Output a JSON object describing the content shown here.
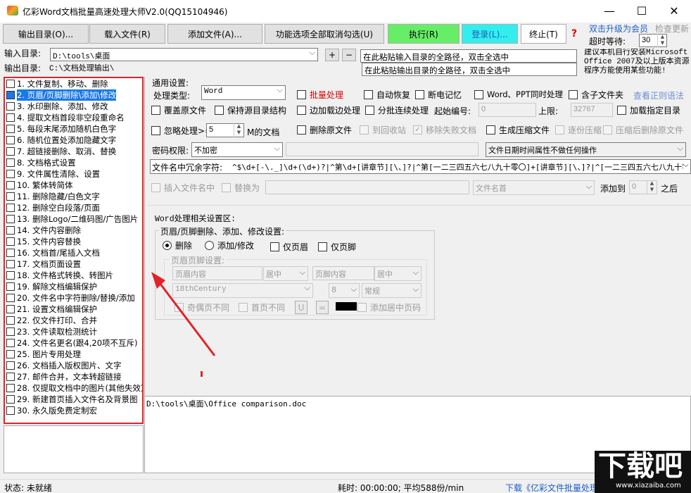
{
  "window": {
    "title": "亿彩Word文档批量高速处理大师V2.0(QQ15104946)",
    "controls": {
      "minimize": "—",
      "maximize": "☐",
      "close": "✕"
    }
  },
  "toolbar": {
    "output_dir": "输出目录(O)...",
    "load_file": "载入文件(R)",
    "add_file": "添加文件(A)...",
    "toggle_all": "功能选项全部取消勾选(U)",
    "execute": "执行(R)",
    "login": "登录(L)...",
    "stop": "终止(T)",
    "help": "?",
    "upgrade": "双击升级为会员",
    "check_update": "检查更新",
    "timeout_label": "超时等待:",
    "timeout_value": "30"
  },
  "paths": {
    "input_label": "输入目录:",
    "input_value": "D:\\tools\\桌面",
    "output_label": "输出目录:",
    "output_value": "C:\\文档处理输出\\",
    "input_hint": "在此粘贴输入目录的全路径，双击全选中",
    "output_hint": "在此粘贴输出目录的全路径，双击全选中",
    "add_btn": "+",
    "remove_btn": "−",
    "notice": "建议本机自行安装Microsoft Office 2007及以上版本资源 程序方能使用某些功能!"
  },
  "function_list": [
    "1. 文件复制、移动、删除",
    "2. 页眉/页脚删除\\添加\\修改",
    "3. 水印删除、添加、修改",
    "4. 提取文档首段非空段重命名",
    "5. 每段末尾添加随机白色字",
    "6. 随机位置处添加隐藏文字",
    "7. 超链接删除、取消、替换",
    "8. 文档格式设置",
    "9. 文件属性清除、设置",
    "10. 繁体转简体",
    "11. 删除隐藏/白色文字",
    "12. 删除空白段落/页面",
    "13. 删除Logo/二维码图/广告图片",
    "14. 文件内容删除",
    "15. 文件内容替换",
    "16. 文档首/尾插入文档",
    "17. 文档页面设置",
    "18. 文件格式转换、转图片",
    "19. 解除文档编辑保护",
    "20. 文件名中字符删除/替换/添加",
    "21. 设置文档编辑保护",
    "22. 仅文件打印、合并",
    "23. 文件读取检测统计",
    "24. 文件名更名(跟4,20项不互斥)",
    "25. 图片专用处理",
    "26. 文档插入版权图片、文字",
    "27. 邮件合并，文本转超链接",
    "28. 仅提取文档中的图片(其他失效)",
    "29. 新建首页插入文件名及背景图",
    "30. 永久版免费定制宏"
  ],
  "general": {
    "section": "通用设置:",
    "type_label": "处理类型:",
    "type_value": "Word",
    "batch": "批量处理",
    "auto_restore": "自动恢复",
    "power_memory": "断电记忆",
    "word_ppt": "Word、PPT同时处理",
    "subfolder": "含子文件夹",
    "regex_link": "查看正则语法",
    "overwrite": "覆盖原文件",
    "keep_structure": "保持源目录结构",
    "side_process": "边加载边处理",
    "batch_continuous": "分批连续处理",
    "start_no_label": "起始编号:",
    "start_no_value": "0",
    "upper_label": "上限:",
    "upper_value": "32767",
    "load_dir": "加载指定目录",
    "ignore_label": "忽略处理>=",
    "ignore_value": "5",
    "ignore_unit": "M的文档",
    "delete_source": "删除原文件",
    "to_recycle": "到回收站",
    "remove_failed": "移除失败文档",
    "gen_zip": "生成压缩文件",
    "one_by_one": "逐份压缩",
    "delete_after_zip": "压缩后删除原文件",
    "password_label": "密码权限:",
    "password_value": "不加密",
    "date_option": "文件日期时间属性不做任何操作",
    "redundant_label": "文件名中冗余字符:",
    "redundant_value": "^$\\d+[-\\._]\\d+(\\d+)?|^第\\d+[讲章节][\\、]?|^第[一二三四五六七八九十零〇]+[讲章节][\\、]?|^[一二三四五六七八九十零",
    "insert_in_name": "插入文件名中",
    "replace_as": "替换为",
    "name_pos": "文件名首",
    "add_to": "添加到",
    "add_to_value": "0",
    "add_to_unit": "之后"
  },
  "word_settings": {
    "section": "Word处理相关设置区:",
    "hf_title": "页眉/页脚删除、添加、修改设置:",
    "delete": "删除",
    "add_modify": "添加/修改",
    "header_only": "仅页眉",
    "footer_only": "仅页脚",
    "hf_sub": "页眉页脚设置:",
    "header_content": "页眉内容",
    "header_align": "居中",
    "footer_content": "页脚内容",
    "footer_align": "居中",
    "font": "18thCentury",
    "size": "8",
    "style": "常规",
    "odd_even": "奇偶页不同",
    "first_diff": "首页不同",
    "u_btn": "U",
    "eq_btn": "=",
    "add_page_no": "添加居中页码"
  },
  "log": {
    "line": "D:\\tools\\桌面\\Office comparison.doc"
  },
  "statusbar": {
    "status": "状态: 未就绪",
    "time": "耗时: 00:00:00; 平均588份/min",
    "download": "下载《亿彩文件批量处理"
  },
  "watermark": {
    "big": "下载吧",
    "url": "www.xiazaiba.com"
  },
  "colors": {
    "accent_red": "#e0242a",
    "exec_green": "#66ee66",
    "login_cyan": "#33eeee",
    "link_blue": "#1a5ec9",
    "selection_blue": "#1979e6"
  }
}
